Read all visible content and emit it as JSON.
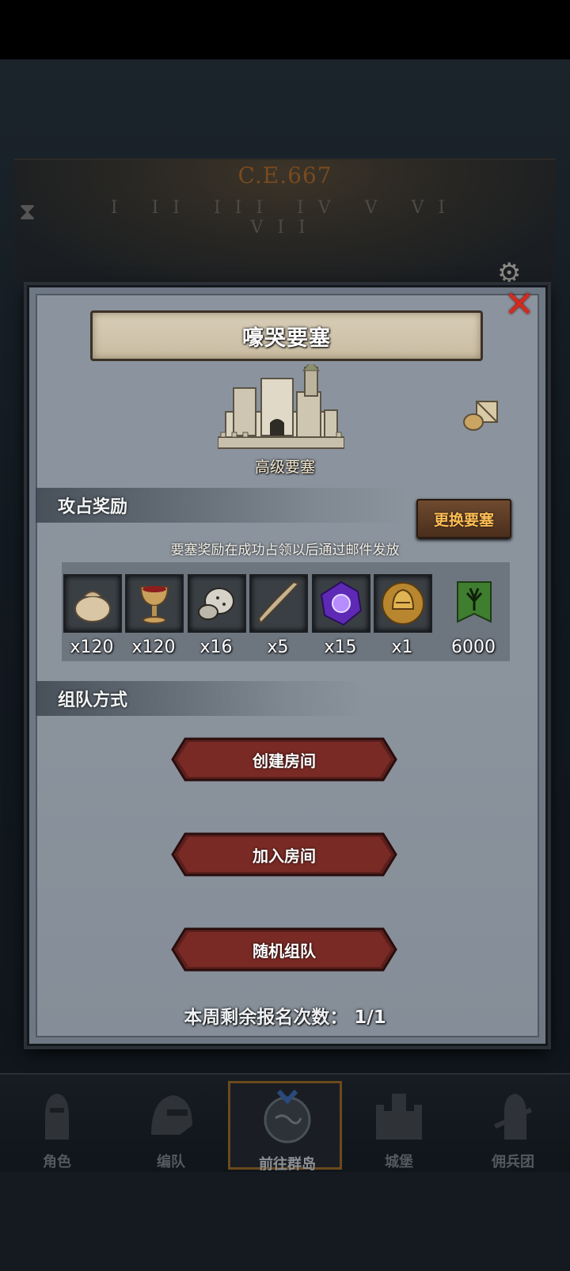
{
  "background": {
    "era": "C.E.667"
  },
  "dialog": {
    "title": "嚎哭要塞",
    "fortress_label": "高级要塞",
    "reward_section": "攻占奖励",
    "change_button": "更换要塞",
    "reward_note": "要塞奖励在成功占领以后通过邮件发放",
    "rewards": [
      {
        "icon": "sack-icon",
        "qty": "x120"
      },
      {
        "icon": "goblet-icon",
        "qty": "x120"
      },
      {
        "icon": "ore-icon",
        "qty": "x16"
      },
      {
        "icon": "horn-icon",
        "qty": "x5"
      },
      {
        "icon": "purple-crystal-icon",
        "qty": "x15"
      },
      {
        "icon": "helmet-coin-icon",
        "qty": "x1"
      },
      {
        "icon": "tree-banner-icon",
        "qty": "6000"
      }
    ],
    "team_section": "组队方式",
    "buttons": {
      "create": "创建房间",
      "join": "加入房间",
      "random": "随机组队"
    },
    "signup_label": "本周剩余报名次数：",
    "signup_count": "1/1"
  },
  "nav": [
    {
      "label": "角色",
      "icon": "knight-icon"
    },
    {
      "label": "编队",
      "icon": "helmet-icon"
    },
    {
      "label": "前往群岛",
      "icon": "globe-icon"
    },
    {
      "label": "城堡",
      "icon": "castle-icon"
    },
    {
      "label": "佣兵团",
      "icon": "mercenary-icon"
    }
  ],
  "colors": {
    "accent": "#ffbe55",
    "button": "#7a2a25",
    "panel": "#8b949e",
    "close": "#d52a1c"
  }
}
